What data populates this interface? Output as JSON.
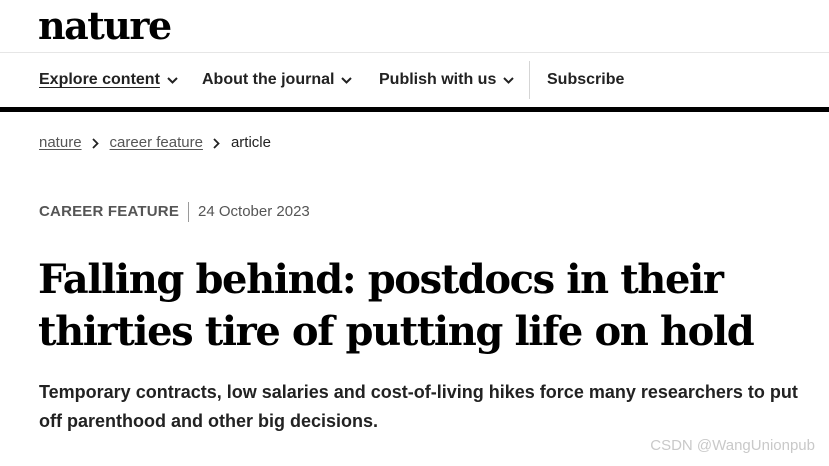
{
  "site": {
    "logo": "nature"
  },
  "nav": {
    "items": [
      {
        "label": "Explore content"
      },
      {
        "label": "About the journal"
      },
      {
        "label": "Publish with us"
      }
    ],
    "subscribe": "Subscribe"
  },
  "breadcrumb": {
    "items": [
      {
        "label": "nature"
      },
      {
        "label": "career feature"
      },
      {
        "label": "article"
      }
    ]
  },
  "article": {
    "type": "CAREER FEATURE",
    "date": "24 October 2023",
    "title": "Falling behind: postdocs in their thirties tire of putting life on hold",
    "standfirst": "Temporary contracts, low salaries and cost-of-living hikes force many researchers to put off parenthood and other big decisions."
  },
  "watermark": "CSDN @WangUnionpub"
}
